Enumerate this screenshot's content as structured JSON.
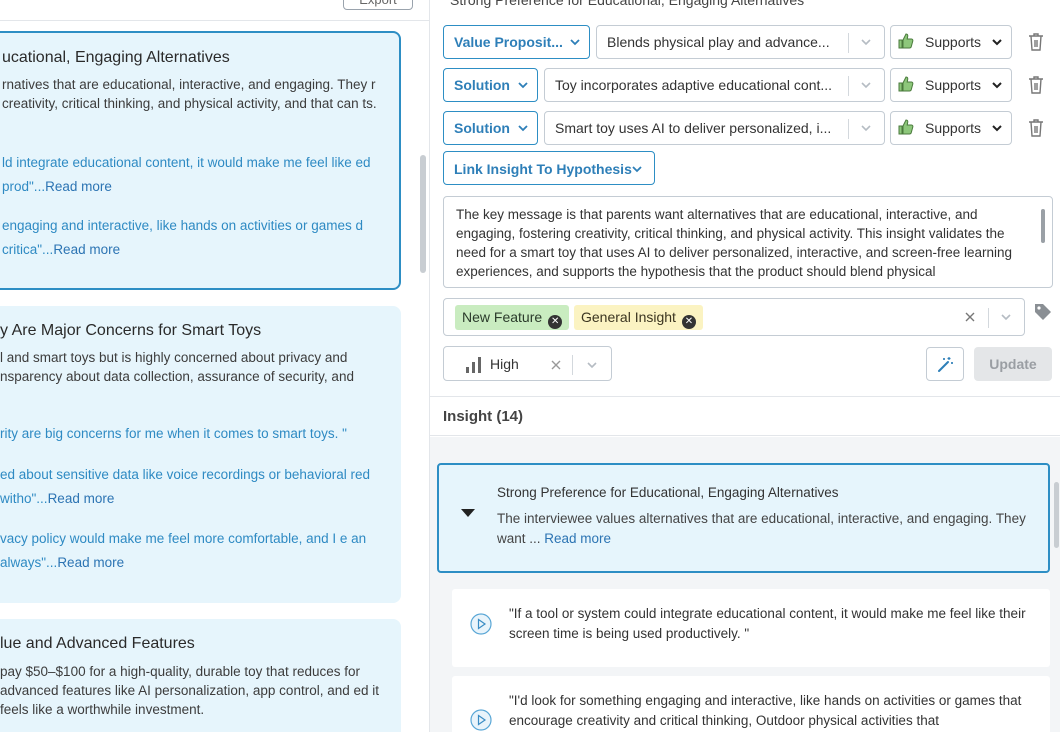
{
  "left": {
    "export_label": "Export",
    "cards": [
      {
        "title": "ucational, Engaging Alternatives",
        "body": "rnatives that are educational, interactive, and engaging. They r creativity, critical thinking, and physical activity, and that can ts.",
        "quotes": [
          {
            "text": "ld integrate educational content, it would make me feel like ed prod\"...",
            "more": "Read more"
          },
          {
            "text": "engaging and interactive, like hands on activities or games d critica\"...",
            "more": "Read more"
          }
        ]
      },
      {
        "title": "y Are Major Concerns for Smart Toys",
        "body": "l and smart toys but is highly concerned about privacy and nsparency about data collection, assurance of security, and",
        "quotes": [
          {
            "text": "rity are big concerns for me when it comes to smart toys. \"",
            "more": ""
          },
          {
            "text": "ed about sensitive data like voice recordings or behavioral red witho\"...",
            "more": "Read more"
          },
          {
            "text": "vacy policy would make me feel more comfortable, and I e an always\"...",
            "more": "Read more"
          }
        ]
      },
      {
        "title": "lue and Advanced Features",
        "body": "pay $50–$100 for a high-quality, durable toy that reduces for advanced features like AI personalization, app control, and ed it feels like a worthwhile investment.",
        "quotes": []
      }
    ]
  },
  "right": {
    "cut_title": "Strong Preference for Educational, Engaging Alternatives",
    "links": [
      {
        "type": "Value Proposit...",
        "item": "Blends physical play and advance...",
        "relation": "Supports"
      },
      {
        "type": "Solution",
        "item": "Toy incorporates adaptive educational cont...",
        "relation": "Supports"
      },
      {
        "type": "Solution",
        "item": "Smart toy uses AI to deliver personalized, i...",
        "relation": "Supports"
      }
    ],
    "link_button": "Link Insight To Hypothesis",
    "description": "The key message is that parents want alternatives that are educational, interactive, and engaging, fostering creativity, critical thinking, and physical activity. This insight validates the need for a smart toy that uses AI to deliver personalized, interactive, and screen-free learning experiences, and supports the hypothesis that the product should blend physical",
    "tags": [
      "New Feature",
      "General Insight"
    ],
    "priority": "High",
    "update_label": "Update",
    "insight_header": "Insight (14)",
    "insight": {
      "title": "Strong Preference for Educational, Engaging Alternatives",
      "desc": "The interviewee values alternatives that are educational, interactive, and engaging. They want ... ",
      "more": "Read more"
    },
    "quotes": [
      "\"If a tool or system could integrate educational content, it would make me feel like their screen time is being used productively. \"",
      "\"I'd look for something engaging and interactive, like hands on activities or games that encourage creativity and critical thinking, Outdoor physical activities that"
    ]
  }
}
